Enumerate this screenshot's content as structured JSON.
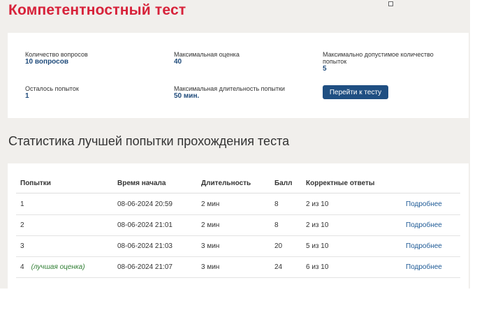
{
  "page": {
    "title": "Компетентностный тест"
  },
  "info": {
    "questions_label": "Количество вопросов",
    "questions_value": "10 вопросов",
    "max_score_label": "Максимальная оценка",
    "max_score_value": "40",
    "max_attempts_label": "Максимально допустимое количество попыток",
    "max_attempts_value": "5",
    "remaining_label": "Осталось попыток",
    "remaining_value": "1",
    "max_duration_label": "Максимальная длительность попытки",
    "max_duration_value": "50 мин.",
    "go_button": "Перейти к тесту"
  },
  "stats": {
    "title": "Статистика лучшей попытки прохождения теста",
    "headers": {
      "attempts": "Попытки",
      "start_time": "Время начала",
      "duration": "Длительность",
      "score": "Балл",
      "correct": "Корректные ответы"
    },
    "rows": [
      {
        "attempt": "1",
        "note": "",
        "start": "08-06-2024 20:59",
        "duration": "2 мин",
        "score": "8",
        "correct": "2 из 10",
        "details": "Подробнее"
      },
      {
        "attempt": "2",
        "note": "",
        "start": "08-06-2024 21:01",
        "duration": "2 мин",
        "score": "8",
        "correct": "2 из 10",
        "details": "Подробнее"
      },
      {
        "attempt": "3",
        "note": "",
        "start": "08-06-2024 21:03",
        "duration": "3 мин",
        "score": "20",
        "correct": "5 из 10",
        "details": "Подробнее"
      },
      {
        "attempt": "4",
        "note": "(лучшая оценка)",
        "start": "08-06-2024 21:07",
        "duration": "3 мин",
        "score": "24",
        "correct": "6 из 10",
        "details": "Подробнее"
      }
    ]
  },
  "colors": {
    "title": "#d7223a",
    "accent": "#1f4f82",
    "best": "#2e7d32",
    "background": "#f1efec"
  }
}
